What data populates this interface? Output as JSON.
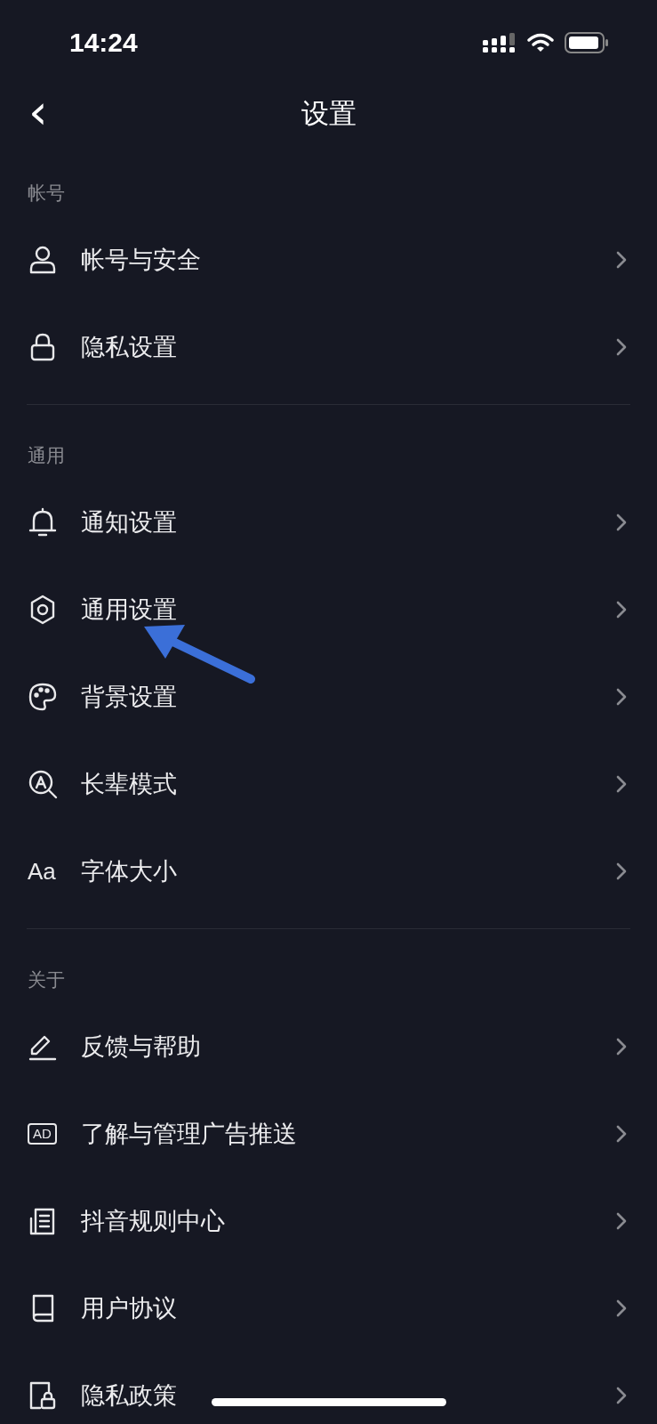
{
  "status_bar": {
    "time": "14:24"
  },
  "header": {
    "back": "‹",
    "title": "设置"
  },
  "sections": [
    {
      "title": "帐号",
      "items": [
        {
          "kind": "person",
          "label": "帐号与安全"
        },
        {
          "kind": "lock",
          "label": "隐私设置"
        }
      ]
    },
    {
      "title": "通用",
      "items": [
        {
          "kind": "bell",
          "label": "通知设置"
        },
        {
          "kind": "gear",
          "label": "通用设置"
        },
        {
          "kind": "palette",
          "label": "背景设置"
        },
        {
          "kind": "magnifier",
          "label": "长辈模式"
        },
        {
          "kind": "text",
          "icon_text": "Aa",
          "label": "字体大小"
        }
      ]
    },
    {
      "title": "关于",
      "items": [
        {
          "kind": "pencil",
          "label": "反馈与帮助"
        },
        {
          "kind": "badge",
          "icon_text": "AD",
          "label": "了解与管理广告推送"
        },
        {
          "kind": "document",
          "label": "抖音规则中心"
        },
        {
          "kind": "book",
          "label": "用户协议"
        },
        {
          "kind": "file-lock",
          "label": "隐私政策"
        }
      ]
    }
  ],
  "annotation": {
    "kind": "arrow"
  }
}
